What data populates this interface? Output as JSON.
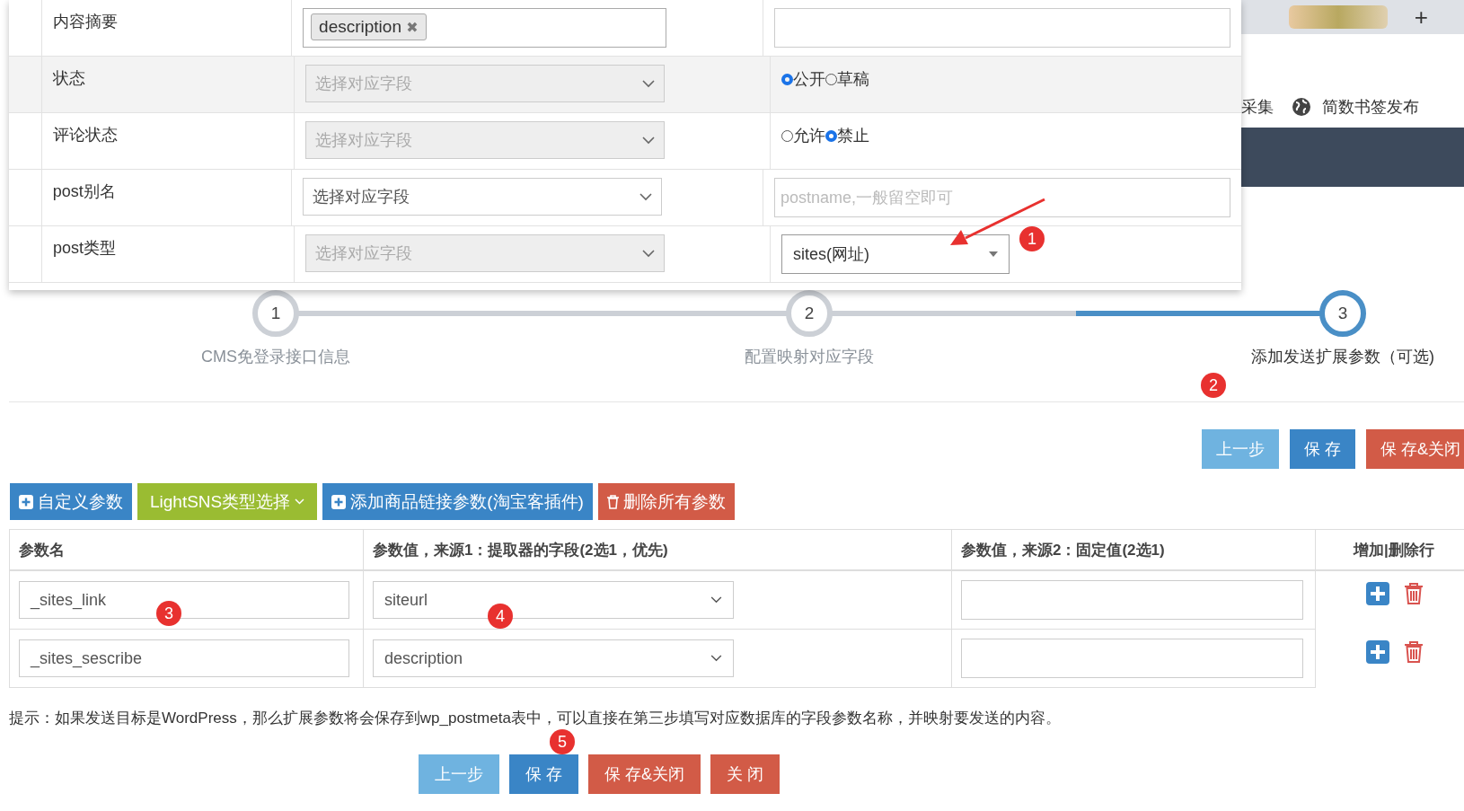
{
  "mapping_rows": [
    {
      "label": "内容摘要",
      "highlighted": false,
      "field": {
        "kind": "tags",
        "tags": [
          {
            "label": "description",
            "remove": "✖"
          }
        ]
      },
      "value": {
        "kind": "input"
      }
    },
    {
      "label": "状态",
      "highlighted": true,
      "field": {
        "kind": "select",
        "placeholder": "选择对应字段",
        "disabled": true
      },
      "value": {
        "kind": "radio",
        "options": [
          {
            "label": "公开",
            "selected": true
          },
          {
            "label": "草稿",
            "selected": false
          }
        ]
      }
    },
    {
      "label": "评论状态",
      "highlighted": false,
      "field": {
        "kind": "select",
        "placeholder": "选择对应字段",
        "disabled": true
      },
      "value": {
        "kind": "radio",
        "options": [
          {
            "label": "允许",
            "selected": false
          },
          {
            "label": "禁止",
            "selected": true
          }
        ]
      }
    },
    {
      "label": "post别名",
      "highlighted": false,
      "field": {
        "kind": "select",
        "placeholder": "选择对应字段",
        "disabled": false
      },
      "value": {
        "kind": "input",
        "placeholder": "postname,一般留空即可"
      }
    },
    {
      "label": "post类型",
      "highlighted": false,
      "field": {
        "kind": "select",
        "placeholder": "选择对应字段",
        "disabled": true
      },
      "value": {
        "kind": "dropdown",
        "value": "sites(网址)"
      }
    }
  ],
  "background_page": {
    "tab_button": "+",
    "nav_items": [
      "采集",
      "简数书签发布"
    ]
  },
  "steps": [
    {
      "number": "1",
      "label": "CMS免登录接口信息",
      "selected": false
    },
    {
      "number": "2",
      "label": "配置映射对应字段",
      "selected": false
    },
    {
      "number": "3",
      "label": "添加发送扩展参数（可选)",
      "selected": true
    }
  ],
  "top_buttons": [
    {
      "label": "上一步",
      "kind": "light"
    },
    {
      "label": "保 存",
      "kind": "primary"
    },
    {
      "label": "保 存&关闭",
      "kind": "danger"
    }
  ],
  "toolbar": [
    {
      "label": "自定义参数",
      "kind": "add"
    },
    {
      "label": "LightSNS类型选择",
      "kind": "dropdown"
    },
    {
      "label": "添加商品链接参数(淘宝客插件)",
      "kind": "add"
    },
    {
      "label": "删除所有参数",
      "kind": "delete"
    }
  ],
  "params_table": {
    "columns": [
      "参数名",
      "参数值，来源1：提取器的字段(2选1，优先)",
      "参数值，来源2：固定值(2选1)",
      "增加|删除行"
    ],
    "rows": [
      {
        "name": "_sites_link",
        "source_field": "siteurl"
      },
      {
        "name": "_sites_sescribe",
        "source_field": "description"
      }
    ]
  },
  "tip": "提示：如果发送目标是WordPress，那么扩展参数将会保存到wp_postmeta表中，可以直接在第三步填写对应数据库的字段参数名称，并映射要发送的内容。",
  "bottom_buttons": [
    {
      "label": "上一步",
      "kind": "light"
    },
    {
      "label": "保 存",
      "kind": "primary"
    },
    {
      "label": "保 存&关闭",
      "kind": "danger"
    },
    {
      "label": "关 闭",
      "kind": "danger"
    }
  ],
  "annotations": [
    "1",
    "2",
    "3",
    "4",
    "5"
  ]
}
